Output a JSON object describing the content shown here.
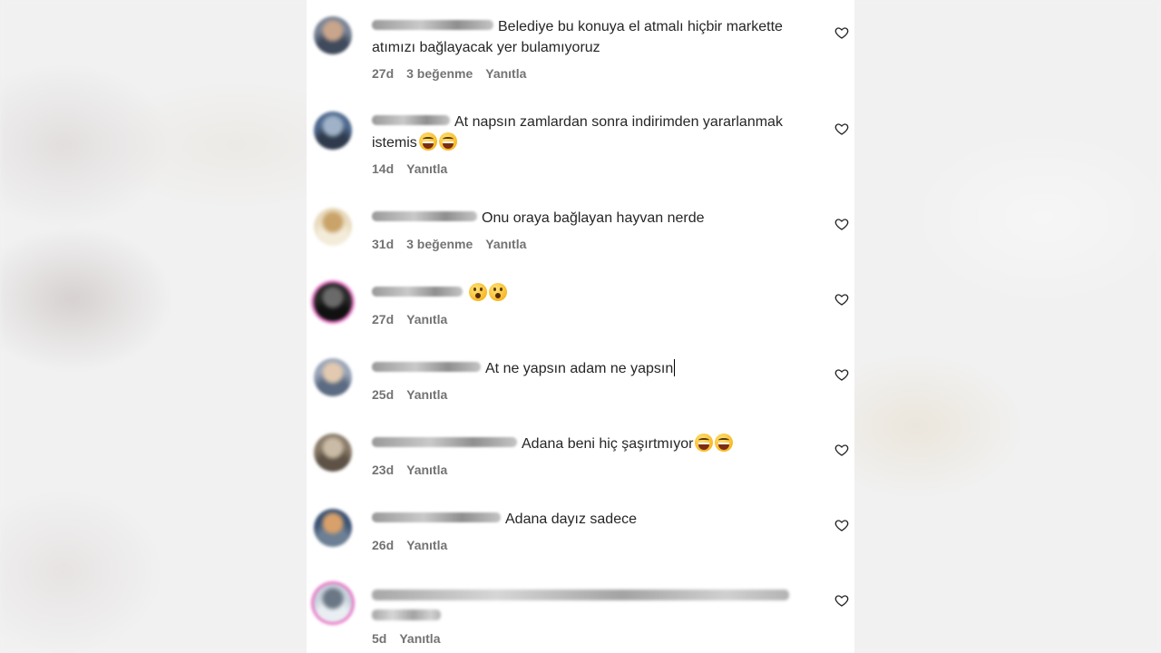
{
  "comments": [
    {
      "text": "Belediye bu konuya el atmalı hiçbir markette atımızı bağlayacak yer bulamıyoruz",
      "emojis": [],
      "time": "27d",
      "likes": "3 beğenme",
      "reply": "Yanıtla",
      "avatar_colors": [
        "#7a8597",
        "#c9a58b",
        "#3f4a5c"
      ]
    },
    {
      "text": "At napsın zamlardan sonra indirimden yararlanmak istemis",
      "emojis": [
        "face-with-tears-of-joy",
        "face-with-tears-of-joy"
      ],
      "time": "14d",
      "likes": "",
      "reply": "Yanıtla",
      "avatar_colors": [
        "#4f6a8f",
        "#9fb2c8",
        "#2f3b4d"
      ]
    },
    {
      "text": "Onu oraya bağlayan hayvan nerde",
      "emojis": [],
      "time": "31d",
      "likes": "3 beğenme",
      "reply": "Yanıtla",
      "avatar_colors": [
        "#e9dcc0",
        "#c9a36a",
        "#f4ecda"
      ]
    },
    {
      "text": "",
      "emojis": [
        "face-with-open-mouth",
        "face-with-open-mouth"
      ],
      "time": "27d",
      "likes": "",
      "reply": "Yanıtla",
      "avatar_colors": [
        "#2a2a2a",
        "#6a6a6a",
        "#111111"
      ]
    },
    {
      "text": "At ne yapsın adam ne yapsın",
      "emojis": [],
      "time": "25d",
      "likes": "",
      "reply": "Yanıtla",
      "avatar_colors": [
        "#9aa6b8",
        "#e2c9b0",
        "#5b6b82"
      ]
    },
    {
      "text": "Adana beni hiç şaşırtmıyor",
      "emojis": [
        "face-with-tears-of-joy",
        "face-with-tears-of-joy"
      ],
      "time": "23d",
      "likes": "",
      "reply": "Yanıtla",
      "avatar_colors": [
        "#8a7c6a",
        "#c9bba5",
        "#5d5245"
      ]
    },
    {
      "text": "Adana dayız sadece",
      "emojis": [],
      "time": "26d",
      "likes": "",
      "reply": "Yanıtla",
      "avatar_colors": [
        "#3b5374",
        "#d8a06a",
        "#6c7f95"
      ]
    },
    {
      "text": "",
      "emojis": [],
      "time": "5d",
      "likes": "",
      "reply": "Yanıtla",
      "avatar_colors": [
        "#c7d2dc",
        "#6b7785",
        "#e9eef2"
      ]
    }
  ]
}
